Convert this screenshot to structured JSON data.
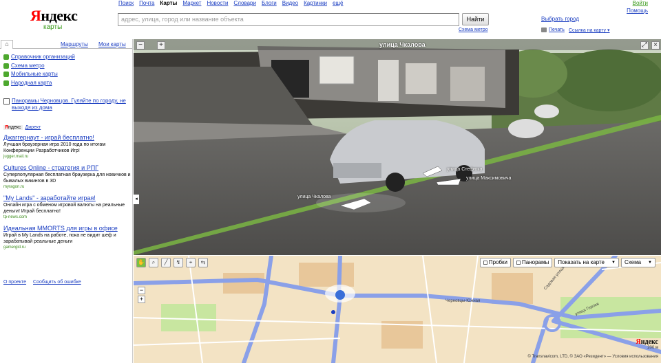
{
  "logo": {
    "first_letter": "Я",
    "rest": "ндекс",
    "subtitle": "карты"
  },
  "services": [
    {
      "label": "Поиск"
    },
    {
      "label": "Почта"
    },
    {
      "label": "Карты",
      "current": true
    },
    {
      "label": "Маркет"
    },
    {
      "label": "Новости"
    },
    {
      "label": "Словари"
    },
    {
      "label": "Блоги"
    },
    {
      "label": "Видео"
    },
    {
      "label": "Картинки"
    },
    {
      "label": "ещё"
    }
  ],
  "header": {
    "search_placeholder": "адрес, улица, город или название объекта",
    "find_button": "Найти",
    "select_city": "Выбрать город",
    "metro_link": "Схема метро",
    "print_link": "Печать",
    "share_link": "Ссылка на карту",
    "login": "Войти",
    "help": "Помощь"
  },
  "sidebar": {
    "home_icon": "house-icon",
    "routes_tab": "Маршруты",
    "my_maps_tab": "Мои карты",
    "quick_links": [
      "Справочник организаций",
      "Схема метро",
      "Мобильные карты",
      "Народная карта"
    ],
    "panorama_link": "Панорамы Черновцов. Гуляйте по городу, не выходя из дома",
    "direct_label_first": "Я",
    "direct_label_rest": "ндекс",
    "direct_link": "Директ",
    "ads": [
      {
        "title": "Джаггернаут - играй бесплатно!",
        "desc": "Лучшая браузерная игра 2010 года по итогам Конференции Разработчиков Игр!",
        "url": "jugger.mail.ru"
      },
      {
        "title": "Cultures Online - стратегия и РПГ",
        "desc": "Суперпопулярная бесплатная браузерка для новичков и бывалых викингов в 3D",
        "url": "myragon.ru"
      },
      {
        "title": "\"My Lands\" - заработайте играя!",
        "desc": "Онлайн игра с обменом игровой валюты на реальные деньги! Играй бесплатно!",
        "url": "tp-news.com"
      },
      {
        "title": "Идеальная MMORTS для игры в офисе",
        "desc": "Играй в My Lands на работе, пока не видит шеф и зарабатывай реальные деньги",
        "url": "gamergid.ru"
      }
    ],
    "about": "О проекте",
    "report": "Сообщить об ошибке"
  },
  "streetview": {
    "title": "улица Чкалова",
    "street_labels": [
      "улица Стефюка",
      "улица Максимовича",
      "улица Чкалова"
    ],
    "minus": "−",
    "plus": "+",
    "collapse": "◂"
  },
  "map": {
    "tools": [
      "hand-icon",
      "zoom-icon",
      "ruler-icon",
      "route-icon",
      "marker-icon",
      "share-icon"
    ],
    "traffic": "Пробки",
    "panoramas": "Панорамы",
    "show_on_map": "Показать на карте",
    "map_type": "Схема",
    "zoom_minus": "−",
    "zoom_plus": "+",
    "logo_first": "Я",
    "logo_rest": "ндекс",
    "scale": "200 м",
    "copyright": "© Transnavicom, LTD, © ЗАО «Резидент» — Условия использования",
    "labels": [
      "Черновцы-Южная",
      "Садовая улица",
      "улица Героев"
    ],
    "colors": {
      "road": "#8aa0e8",
      "background": "#f3e3c4",
      "park": "#c8e6a0",
      "building": "#e8c79a"
    }
  }
}
